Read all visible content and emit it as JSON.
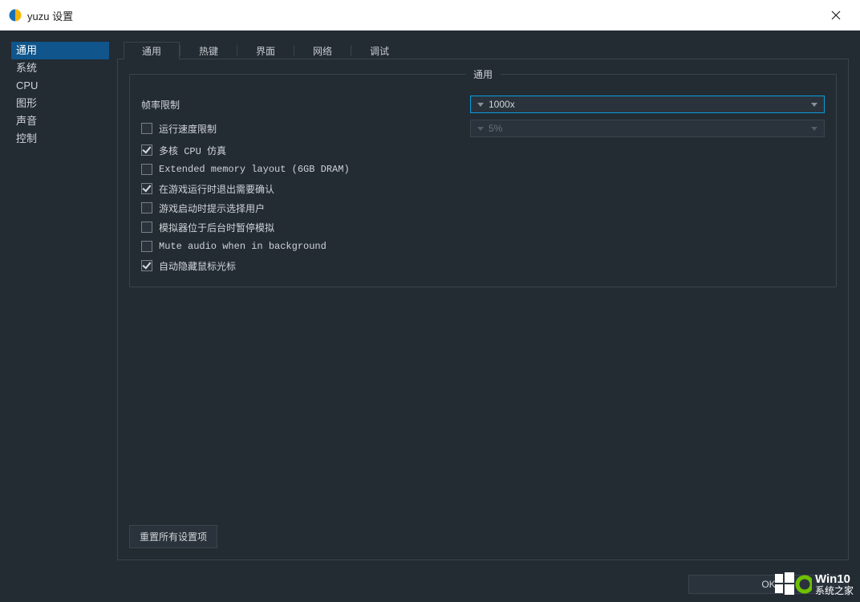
{
  "window": {
    "title": "yuzu 设置"
  },
  "sidebar": {
    "items": [
      {
        "label": "通用",
        "active": true
      },
      {
        "label": "系统",
        "active": false
      },
      {
        "label": "CPU",
        "active": false
      },
      {
        "label": "图形",
        "active": false
      },
      {
        "label": "声音",
        "active": false
      },
      {
        "label": "控制",
        "active": false
      }
    ]
  },
  "tabs": [
    {
      "label": "通用",
      "active": true
    },
    {
      "label": "热键",
      "active": false
    },
    {
      "label": "界面",
      "active": false
    },
    {
      "label": "网络",
      "active": false
    },
    {
      "label": "调试",
      "active": false
    }
  ],
  "group": {
    "legend": "通用",
    "fps_label": "帧率限制",
    "fps_value": "1000x",
    "speed_value": "5%",
    "checks": [
      {
        "label": "运行速度限制",
        "checked": false,
        "mono": false
      },
      {
        "label": "多核 CPU 仿真",
        "checked": true,
        "mono": true
      },
      {
        "label": "Extended memory layout (6GB DRAM)",
        "checked": false,
        "mono": true
      },
      {
        "label": "在游戏运行时退出需要确认",
        "checked": true,
        "mono": false
      },
      {
        "label": "游戏启动时提示选择用户",
        "checked": false,
        "mono": false
      },
      {
        "label": "模拟器位于后台时暂停模拟",
        "checked": false,
        "mono": false
      },
      {
        "label": "Mute audio when in background",
        "checked": false,
        "mono": true
      },
      {
        "label": "自动隐藏鼠标光标",
        "checked": true,
        "mono": false
      }
    ]
  },
  "buttons": {
    "reset": "重置所有设置项",
    "ok": "OK"
  },
  "watermark": {
    "brand_top": "Win10",
    "brand_bottom": "系统之家"
  }
}
